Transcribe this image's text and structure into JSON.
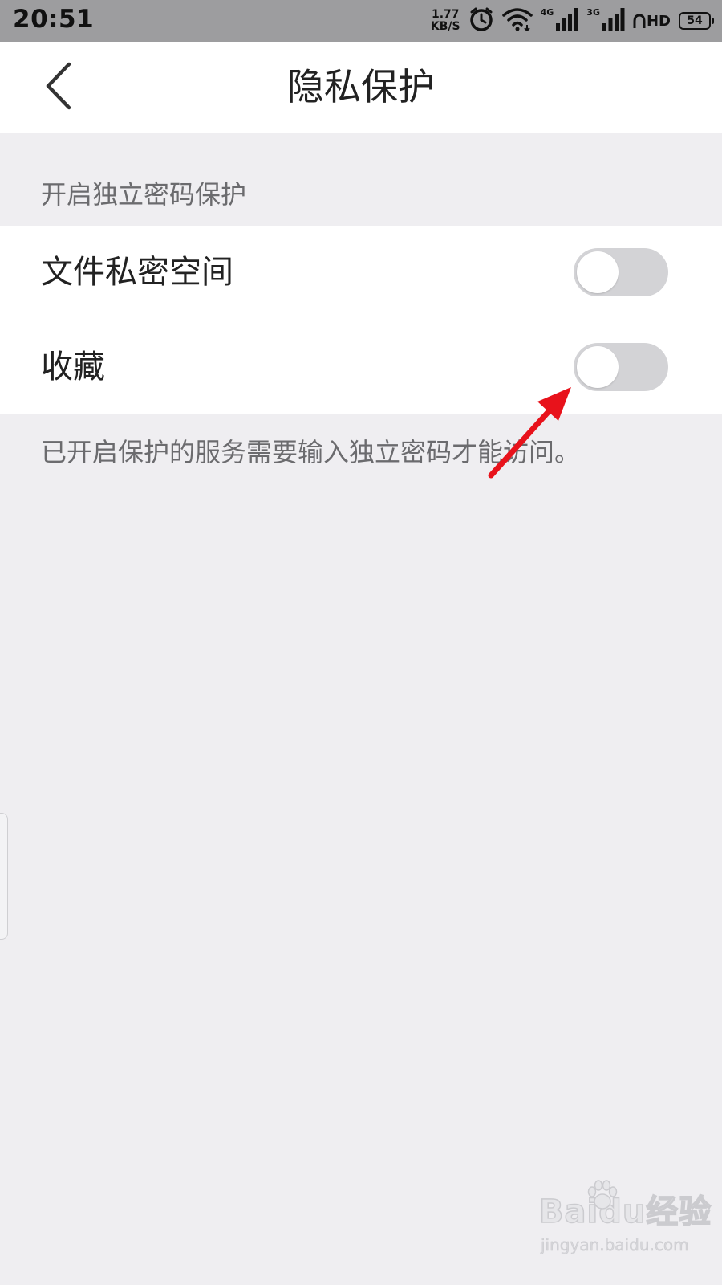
{
  "status_bar": {
    "time": "20:51",
    "net_speed_value": "1.77",
    "net_speed_unit": "KB/S",
    "signal_1_label": "4G",
    "signal_2_label": "3G",
    "hd_label": "HD",
    "battery": "54"
  },
  "header": {
    "title": "隐私保护"
  },
  "section": {
    "title": "开启独立密码保护"
  },
  "items": [
    {
      "label": "文件私密空间",
      "enabled": false
    },
    {
      "label": "收藏",
      "enabled": false
    }
  ],
  "footer_note": "已开启保护的服务需要输入独立密码才能访问。",
  "colors": {
    "page_background": "#efeef1",
    "status_bar": "#9d9d9f",
    "toggle_off": "#d3d3d6",
    "annotation_arrow": "#e8121b"
  },
  "watermark": {
    "text": "Baidu经验",
    "url_text": "jingyan.baidu.com"
  }
}
